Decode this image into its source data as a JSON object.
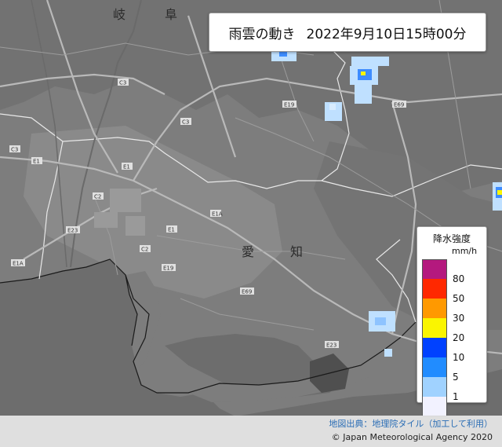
{
  "title": {
    "label": "雨雲の動き",
    "datetime": "2022年9月10日15時00分"
  },
  "legend": {
    "title": "降水強度",
    "unit": "mm/h",
    "levels": [
      {
        "label": "80",
        "color": "#b4197e"
      },
      {
        "label": "50",
        "color": "#ff2800"
      },
      {
        "label": "30",
        "color": "#ff9900"
      },
      {
        "label": "20",
        "color": "#faf500"
      },
      {
        "label": "10",
        "color": "#0041ff"
      },
      {
        "label": "5",
        "color": "#218cff"
      },
      {
        "label": "1",
        "color": "#a0d2ff"
      },
      {
        "label": "",
        "color": "#f2f2ff"
      }
    ]
  },
  "credit": {
    "source": "地図出典：地理院タイル（加工して利用）",
    "copyright": "© Japan Meteorological Agency 2020"
  },
  "map_labels": {
    "gifu_1": "岐",
    "gifu_2": "阜",
    "aichi_1": "愛",
    "aichi_2": "知"
  },
  "road_labels": [
    "C3",
    "C3",
    "C3",
    "C2",
    "C2",
    "E1",
    "E1",
    "E1",
    "E1A",
    "E1A",
    "E19",
    "E19",
    "E69",
    "E69",
    "E23",
    "E23"
  ],
  "precip_cells": [
    {
      "area": "north-center",
      "level": "5"
    },
    {
      "area": "north-east",
      "level": "10"
    },
    {
      "area": "mikawa-east",
      "level": "5"
    },
    {
      "area": "north-center-small",
      "level": "1"
    },
    {
      "area": "east-edge",
      "level": "20"
    }
  ]
}
